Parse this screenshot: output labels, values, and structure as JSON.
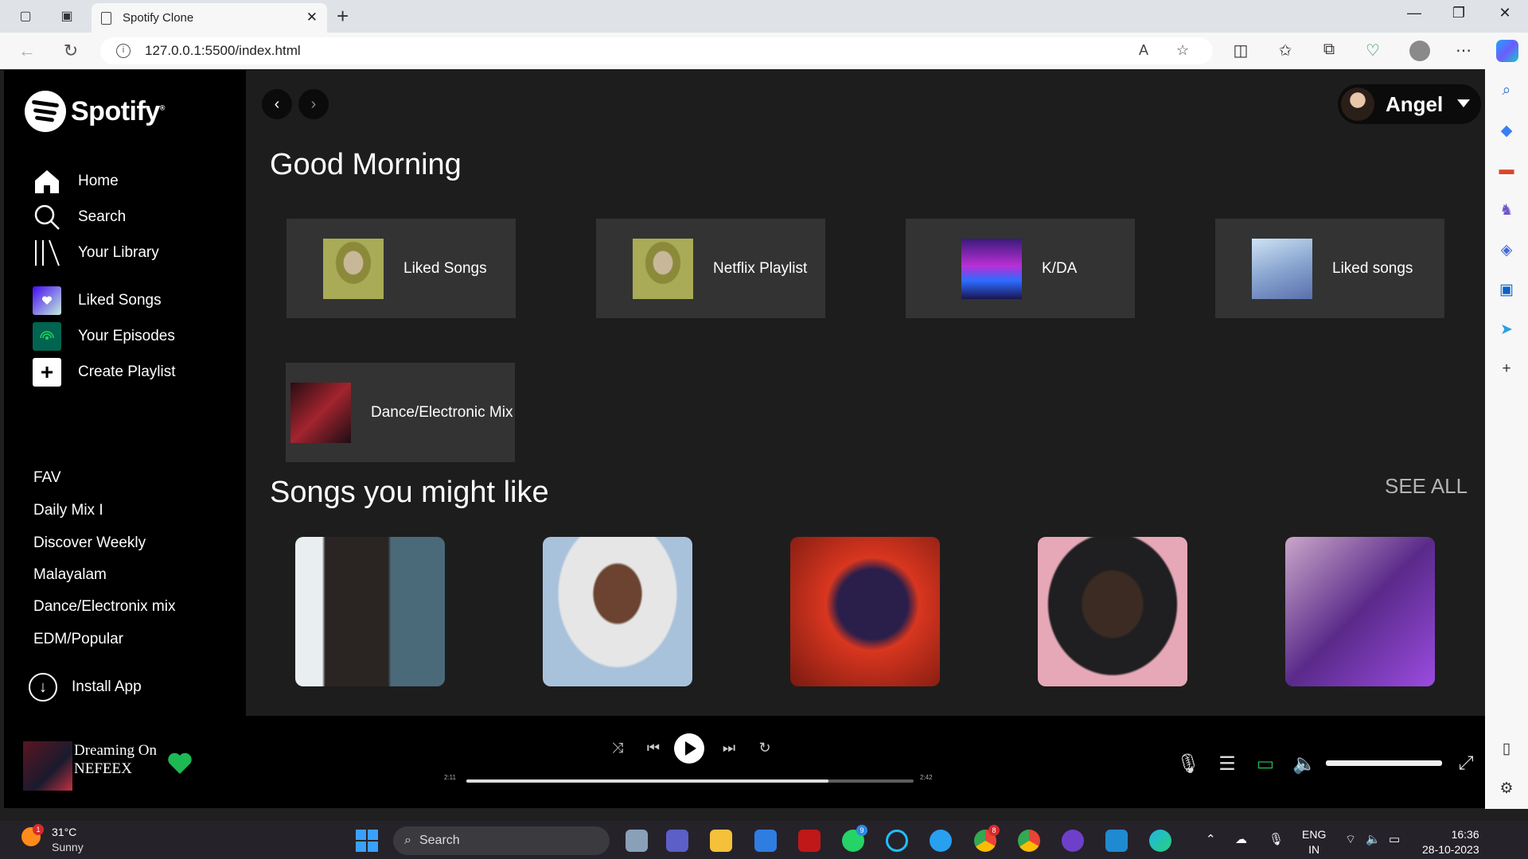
{
  "browser": {
    "tab_title": "Spotify Clone",
    "url": "127.0.0.1:5500/index.html"
  },
  "sidebar": {
    "logo_text": "Spotify",
    "nav": [
      {
        "label": "Home",
        "icon": "home-icon"
      },
      {
        "label": "Search",
        "icon": "search-icon"
      },
      {
        "label": "Your Library",
        "icon": "library-icon"
      }
    ],
    "shortcuts": [
      {
        "label": "Liked Songs",
        "icon": "heart-icon"
      },
      {
        "label": "Your Episodes",
        "icon": "podcast-icon"
      },
      {
        "label": "Create Playlist",
        "icon": "plus-icon"
      }
    ],
    "playlists": [
      "FAV",
      "Daily Mix I",
      "Discover Weekly",
      "Malayalam",
      "Dance/Electronix mix",
      "EDM/Popular"
    ],
    "install_label": "Install App"
  },
  "user": {
    "name": "Angel"
  },
  "main": {
    "greeting": "Good Morning",
    "cards": [
      {
        "label": "Liked Songs"
      },
      {
        "label": "Netflix Playlist"
      },
      {
        "label": "K/DA"
      },
      {
        "label": "Liked songs"
      },
      {
        "label": "Dance/Electronic Mix"
      }
    ],
    "section_title": "Songs you might like",
    "see_all": "SEE ALL"
  },
  "player": {
    "title": "Dreaming On",
    "artist": "NEFEEX",
    "time_elapsed": "2:11",
    "time_total": "2:42",
    "progress": 0.81,
    "volume": 1.0,
    "accent": "#1db954"
  },
  "taskbar": {
    "temperature": "31°C",
    "weather": "Sunny",
    "weather_badge": "1",
    "search": "Search",
    "whatsapp_badge": "9",
    "chrome_badge": "8",
    "lang1": "ENG",
    "lang2": "IN",
    "time": "16:36",
    "date": "28-10-2023"
  }
}
